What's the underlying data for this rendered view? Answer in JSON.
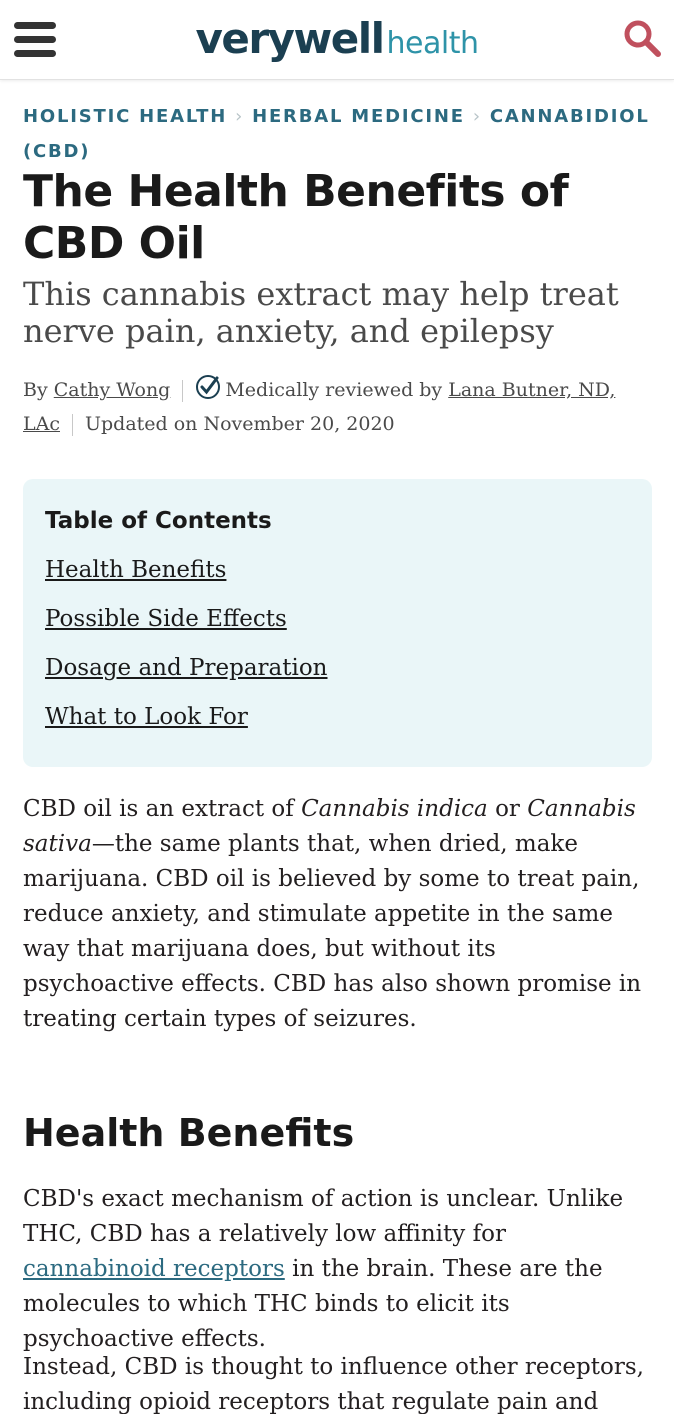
{
  "header": {
    "menu_icon": "hamburger-menu-icon",
    "logo_bold": "verywell",
    "logo_light": "health",
    "search_icon": "search-icon",
    "search_color": "#c0505e"
  },
  "breadcrumb": {
    "items": [
      "HOLISTIC HEALTH",
      "HERBAL MEDICINE",
      "CANNABIDIOL (CBD)"
    ],
    "separator_icon": "chevron-right-icon"
  },
  "article": {
    "title": "The Health Benefits of CBD Oil",
    "subtitle": "This cannabis extract may help treat nerve pain, anxiety, and epilepsy",
    "byline": {
      "by": "By",
      "author": "Cathy Wong",
      "reviewed_label": "Medically reviewed by",
      "reviewer": "Lana Butner, ND, LAc",
      "updated": "Updated on November 20, 2020",
      "check_icon": "verified-check-icon"
    }
  },
  "toc": {
    "heading": "Table of Contents",
    "items": [
      "Health Benefits",
      "Possible Side Effects",
      "Dosage and Preparation",
      "What to Look For"
    ]
  },
  "intro": {
    "p1_text1": "CBD oil is an extract of ",
    "p1_italic1": "Cannabis indica",
    "p1_text2": " or ",
    "p1_italic2": "Cannabis sativa",
    "p1_text3": "—the same plants that, when dried, make marijuana. CBD oil is believed by some to treat pain, reduce anxiety, and stimulate appetite in the same way that marijuana does, but without its psychoactive effects. CBD has also shown promise in treating certain types of seizures."
  },
  "section": {
    "heading": "Health Benefits",
    "p1_text1": "CBD's exact mechanism of action is unclear. Unlike THC, CBD has a relatively low affinity for ",
    "p1_link": "cannabinoid receptors",
    "p1_text2": " in the brain. These are the molecules to which THC binds to elicit its psychoactive effects.",
    "p2_text": "Instead, CBD is thought to influence other receptors, including opioid receptors that regulate pain and"
  },
  "colors": {
    "brand_dark": "#1b3f51",
    "brand_teal": "#2e93a8",
    "breadcrumb": "#2c6a80",
    "toc_bg": "#eaf6f8"
  }
}
